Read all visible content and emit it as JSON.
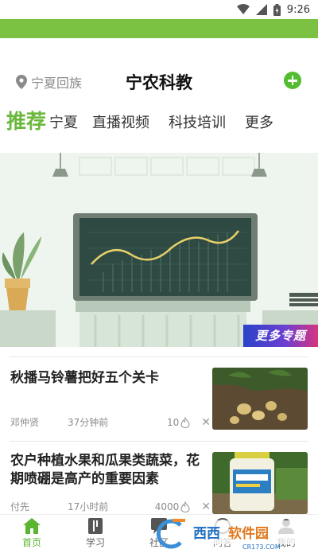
{
  "status_bar": {
    "time": "9:26",
    "icons": [
      "wifi-icon",
      "signal-icon",
      "battery-icon"
    ]
  },
  "header": {
    "location": "宁夏回族",
    "title": "宁农科教",
    "add_icon": "plus-circle-icon"
  },
  "tabs": [
    {
      "label": "推荐",
      "active": true
    },
    {
      "label": "宁夏",
      "active": false
    },
    {
      "label": "直播视频",
      "active": false
    },
    {
      "label": "科技培训",
      "active": false
    },
    {
      "label": "更多",
      "active": false
    }
  ],
  "banner": {
    "badge": "更多专题"
  },
  "news": [
    {
      "title": "秋播马铃薯把好五个关卡",
      "author": "邓仲贤",
      "time": "37分钟前",
      "count": "10"
    },
    {
      "title": "农户种植水果和瓜果类蔬菜，花期喷硼是高产的重要因素",
      "author": "付先",
      "time": "17小时前",
      "count": "4000"
    }
  ],
  "bottom_nav": [
    {
      "label": "首页",
      "icon": "home-icon",
      "active": true
    },
    {
      "label": "学习",
      "icon": "book-icon",
      "active": false
    },
    {
      "label": "社区",
      "icon": "chat-icon",
      "active": false
    },
    {
      "label": "问答",
      "icon": "question-icon",
      "active": false
    },
    {
      "label": "我的",
      "icon": "user-icon",
      "active": false
    }
  ],
  "watermark": {
    "text": "西西软件园",
    "subtext": "CR173.COM"
  },
  "colors": {
    "brand_green": "#7cc242",
    "active_green": "#6ab83b"
  }
}
